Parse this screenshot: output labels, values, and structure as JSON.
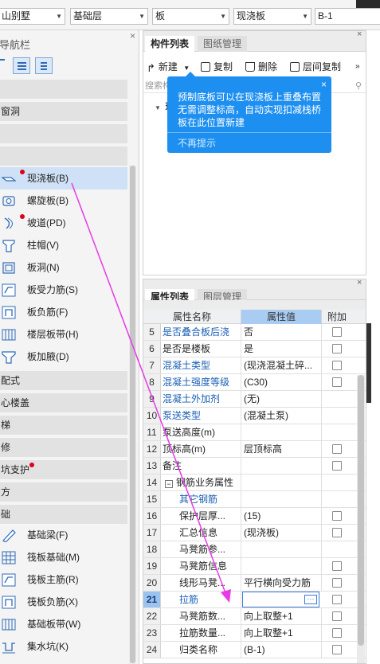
{
  "toolbar": {
    "combos": [
      "山别墅",
      "基础层",
      "板",
      "现浇板",
      "B-1"
    ]
  },
  "nav": {
    "title": "导航栏",
    "sections": [
      "",
      "窗洞",
      "",
      "",
      "配式",
      "心楼盖",
      "梯",
      "修",
      "坑支护",
      "方",
      "础"
    ],
    "slab_items": [
      {
        "label": "现浇板(B)",
        "icon": "cast-slab-icon"
      },
      {
        "label": "螺旋板(B)",
        "icon": "spiral-slab-icon"
      },
      {
        "label": "坡道(PD)",
        "icon": "ramp-icon"
      },
      {
        "label": "柱帽(V)",
        "icon": "column-cap-icon"
      },
      {
        "label": "板洞(N)",
        "icon": "slab-hole-icon"
      },
      {
        "label": "板受力筋(S)",
        "icon": "slab-rebar-icon"
      },
      {
        "label": "板负筋(F)",
        "icon": "negative-rebar-icon"
      },
      {
        "label": "楼层板带(H)",
        "icon": "floor-strip-icon"
      },
      {
        "label": "板加腋(D)",
        "icon": "slab-haunch-icon"
      }
    ],
    "foundation_items": [
      {
        "label": "基础梁(F)",
        "icon": "foundation-beam-icon"
      },
      {
        "label": "筏板基础(M)",
        "icon": "raft-foundation-icon"
      },
      {
        "label": "筏板主筋(R)",
        "icon": "raft-main-rebar-icon"
      },
      {
        "label": "筏板负筋(X)",
        "icon": "raft-negative-rebar-icon"
      },
      {
        "label": "基础板带(W)",
        "icon": "foundation-strip-icon"
      },
      {
        "label": "集水坑(K)",
        "icon": "sump-pit-icon"
      }
    ]
  },
  "components": {
    "tabs": [
      "构件列表",
      "图纸管理"
    ],
    "tools": [
      "新建",
      "复制",
      "删除",
      "层间复制"
    ],
    "search_placeholder": "搜索构",
    "tree_root": "现",
    "tooltip": {
      "message": "预制底板可以在现浇板上重叠布置无需调整标高，自动实现扣减栈桥板在此位置新建",
      "dismiss": "不再提示"
    }
  },
  "properties": {
    "tabs": [
      "属性列表",
      "图层管理"
    ],
    "headers": [
      "属性名称",
      "属性值",
      "附加"
    ],
    "rows": [
      {
        "n": "5",
        "name": "是否叠合板后浇",
        "value": "否",
        "blue": true,
        "chk": true
      },
      {
        "n": "6",
        "name": "是否是楼板",
        "value": "是",
        "blue": false,
        "chk": true
      },
      {
        "n": "7",
        "name": "混凝土类型",
        "value": "(现浇混凝土碎...",
        "blue": true,
        "chk": true
      },
      {
        "n": "8",
        "name": "混凝土强度等级",
        "value": "(C30)",
        "blue": true,
        "chk": true
      },
      {
        "n": "9",
        "name": "混凝土外加剂",
        "value": "(无)",
        "blue": true,
        "chk": false
      },
      {
        "n": "10",
        "name": "泵送类型",
        "value": "(混凝土泵)",
        "blue": true,
        "chk": false
      },
      {
        "n": "11",
        "name": "泵送高度(m)",
        "value": "",
        "blue": false,
        "chk": false
      },
      {
        "n": "12",
        "name": "顶标高(m)",
        "value": "层顶标高",
        "blue": false,
        "chk": true
      },
      {
        "n": "13",
        "name": "备注",
        "value": "",
        "blue": false,
        "chk": true
      },
      {
        "n": "14",
        "name": "钢筋业务属性",
        "value": "",
        "blue": false,
        "chk": false,
        "group": true
      },
      {
        "n": "15",
        "name": "其它钢筋",
        "value": "",
        "blue": true,
        "chk": false,
        "indent": true
      },
      {
        "n": "16",
        "name": "保护层厚...",
        "value": "(15)",
        "blue": false,
        "chk": true,
        "indent": true
      },
      {
        "n": "17",
        "name": "汇总信息",
        "value": "(现浇板)",
        "blue": false,
        "chk": true,
        "indent": true
      },
      {
        "n": "18",
        "name": "马凳筋参...",
        "value": "",
        "blue": false,
        "chk": false,
        "indent": true
      },
      {
        "n": "19",
        "name": "马凳筋信息",
        "value": "",
        "blue": false,
        "chk": true,
        "indent": true
      },
      {
        "n": "20",
        "name": "线形马凳...",
        "value": "平行横向受力筋",
        "blue": false,
        "chk": true,
        "indent": true
      },
      {
        "n": "21",
        "name": "拉筋",
        "value": "",
        "blue": true,
        "chk": true,
        "indent": true,
        "selected": true
      },
      {
        "n": "22",
        "name": "马凳筋数...",
        "value": "向上取整+1",
        "blue": false,
        "chk": true,
        "indent": true
      },
      {
        "n": "23",
        "name": "拉筋数量...",
        "value": "向上取整+1",
        "blue": false,
        "chk": true,
        "indent": true
      },
      {
        "n": "24",
        "name": "归类名称",
        "value": "(B-1)",
        "blue": false,
        "chk": true,
        "indent": true
      }
    ]
  },
  "colors": {
    "accent": "#1d8ff0",
    "link": "#1a5fb4",
    "arrow": "#e83ae8"
  }
}
